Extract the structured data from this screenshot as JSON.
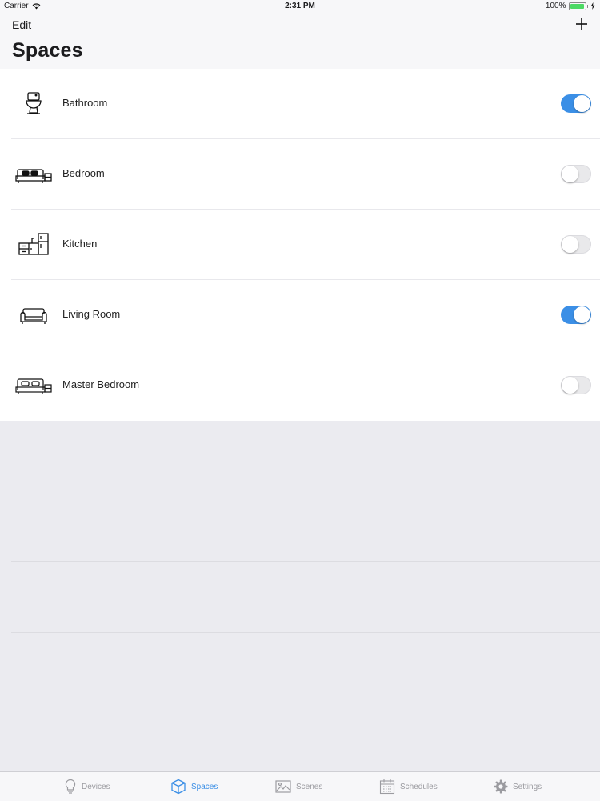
{
  "status": {
    "carrier": "Carrier",
    "time": "2:31 PM",
    "battery": "100%"
  },
  "header": {
    "edit_label": "Edit",
    "title": "Spaces"
  },
  "spaces": [
    {
      "label": "Bathroom",
      "icon": "toilet-icon",
      "on": true
    },
    {
      "label": "Bedroom",
      "icon": "bed-icon",
      "on": false
    },
    {
      "label": "Kitchen",
      "icon": "kitchen-icon",
      "on": false
    },
    {
      "label": "Living Room",
      "icon": "sofa-icon",
      "on": true
    },
    {
      "label": "Master Bedroom",
      "icon": "master-bed-icon",
      "on": false
    }
  ],
  "tabs": [
    {
      "label": "Devices",
      "icon": "lightbulb-icon",
      "active": false
    },
    {
      "label": "Spaces",
      "icon": "cube-icon",
      "active": true
    },
    {
      "label": "Scenes",
      "icon": "image-icon",
      "active": false
    },
    {
      "label": "Schedules",
      "icon": "calendar-icon",
      "active": false
    },
    {
      "label": "Settings",
      "icon": "gear-icon",
      "active": false
    }
  ],
  "colors": {
    "accent": "#3b8fe6",
    "background": "#ebebf0",
    "toggle_off": "#e9e9eb"
  }
}
